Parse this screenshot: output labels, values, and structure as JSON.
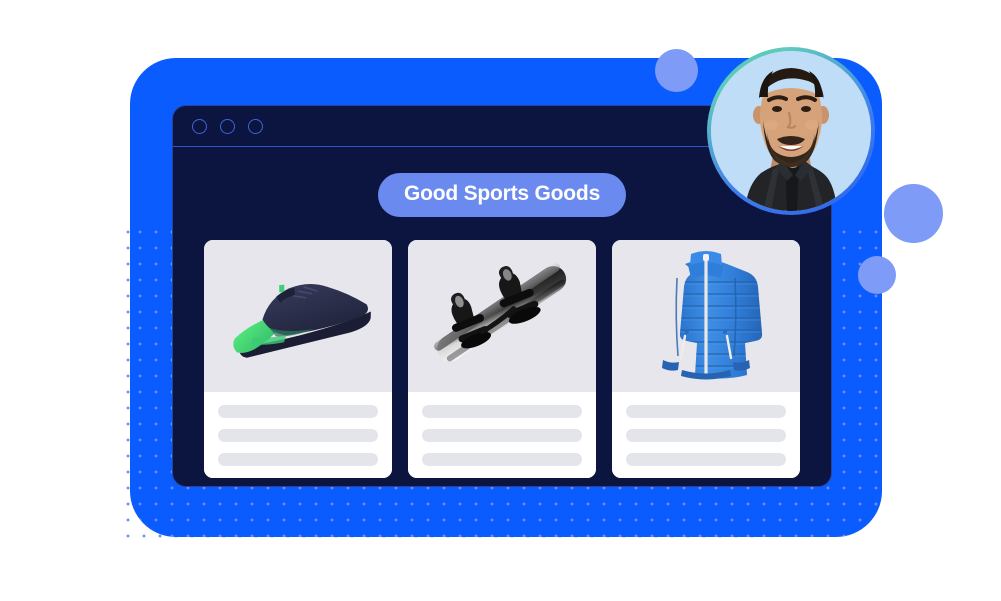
{
  "theme": {
    "page_background": "#ffffff",
    "panel_blue": "#0B5CFF",
    "browser_navy": "#0C1440",
    "browser_border": "#2A4099",
    "divider_blue": "#2F56C8",
    "dot_outline": "#3F63D8",
    "pill_blue": "#6B8AF0",
    "pill_text": "#ffffff",
    "accent_periwinkle": "#7D9BF7",
    "dot_grid": "#6E8FF0",
    "card_white": "#ffffff",
    "photo_gray": "#E6E6EC",
    "placeholder_gray": "#E4E4EB",
    "avatar_ring_from": "#49C3B1",
    "avatar_ring_to": "#2B63E8",
    "avatar_backdrop": "#BFDDF7"
  },
  "browser": {
    "window_controls": [
      {
        "name": "close",
        "style": "outline-circle"
      },
      {
        "name": "minimize",
        "style": "outline-circle"
      },
      {
        "name": "maximize",
        "style": "outline-circle"
      }
    ]
  },
  "store": {
    "title": "Good Sports Goods"
  },
  "products": [
    {
      "id": "running-shoe",
      "art": "running-shoe",
      "colors": {
        "body": "#2B2F52",
        "accent": "#45E06A",
        "sole": "#1C2038",
        "midsole": "#2F6B52"
      },
      "placeholder_lines": 3
    },
    {
      "id": "snowboard",
      "art": "snowboard",
      "colors": {
        "deck_light": "#F2F2F2",
        "deck_dark": "#111111",
        "binding": "#141414"
      },
      "placeholder_lines": 3
    },
    {
      "id": "puffer-jacket",
      "art": "puffer-jacket",
      "colors": {
        "body": "#2E7BD4",
        "body_light": "#3E8EE5",
        "body_dark": "#2566B8",
        "zipper": "#E8E8E8"
      },
      "placeholder_lines": 3
    }
  ],
  "decorations": {
    "circles": [
      {
        "id": "circle-top",
        "color": "#7D9BF7",
        "size": 43
      },
      {
        "id": "circle-large-right",
        "color": "#7D9BF7",
        "size": 59
      },
      {
        "id": "circle-small-right",
        "color": "#7D9BF7",
        "size": 38
      }
    ],
    "dot_grid": {
      "color": "#6E8FF0",
      "spacing": 16
    }
  },
  "avatar": {
    "alt": "smiling bearded man in black shirt"
  }
}
